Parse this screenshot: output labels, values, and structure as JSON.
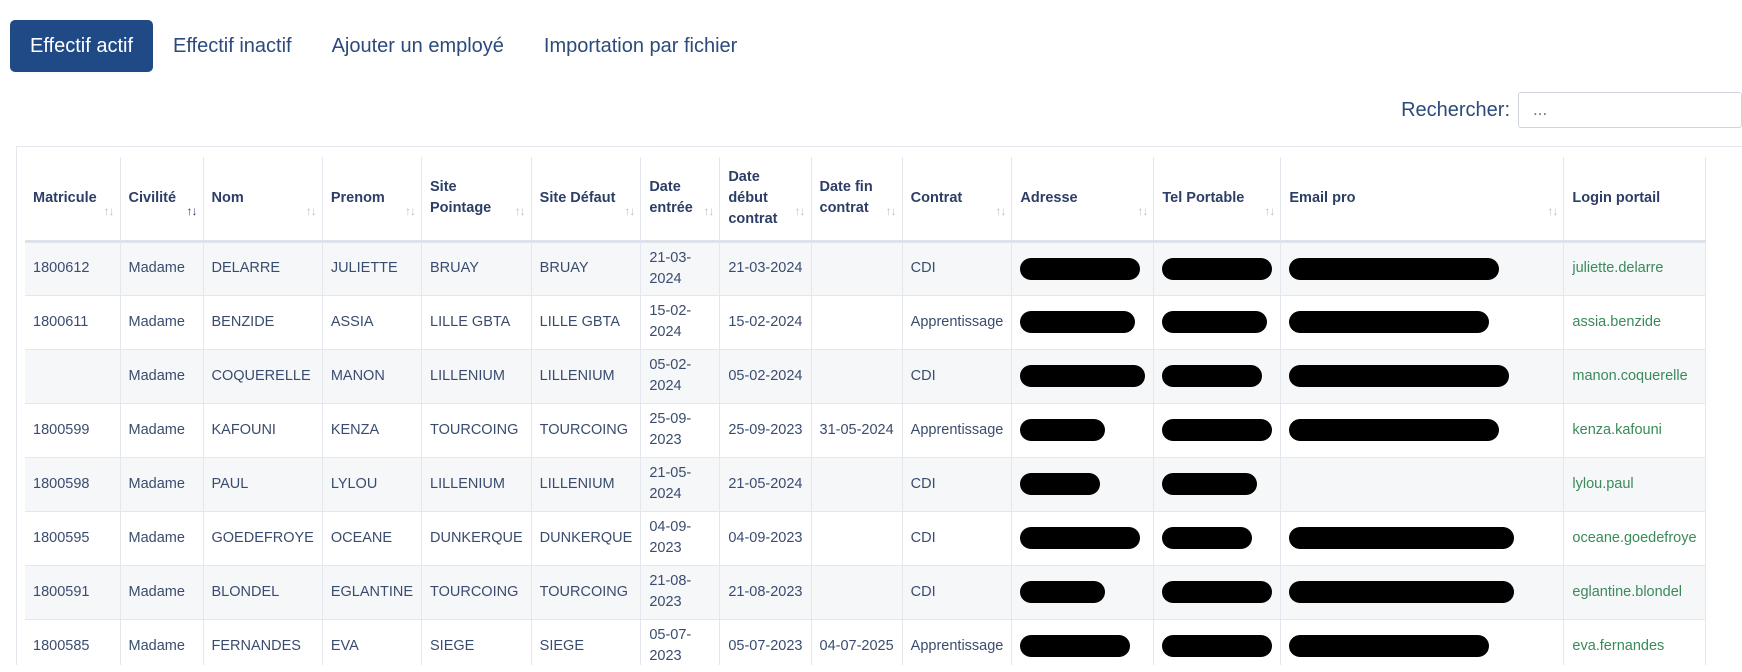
{
  "tabs": [
    "Effectif actif",
    "Effectif inactif",
    "Ajouter un employé",
    "Importation par fichier"
  ],
  "search": {
    "label": "Rechercher:",
    "placeholder": "..."
  },
  "columns": [
    "Matricule",
    "Civilité",
    "Nom",
    "Prenom",
    "Site Pointage",
    "Site Défaut",
    "Date entrée",
    "Date début contrat",
    "Date fin contrat",
    "Contrat",
    "Adresse",
    "Tel Portable",
    "Email pro",
    "Login portail"
  ],
  "sort_icon": "↑↓",
  "rows": [
    {
      "matricule": "1800612",
      "civilite": "Madame",
      "nom": "DELARRE",
      "prenom": "JULIETTE",
      "site_pointage": "BRUAY",
      "site_defaut": "BRUAY",
      "date_entree": "21-03-2024",
      "date_debut": "21-03-2024",
      "date_fin": "",
      "contrat": "CDI",
      "login": "juliette.delarre"
    },
    {
      "matricule": "1800611",
      "civilite": "Madame",
      "nom": "BENZIDE",
      "prenom": "ASSIA",
      "site_pointage": "LILLE GBTA",
      "site_defaut": "LILLE GBTA",
      "date_entree": "15-02-2024",
      "date_debut": "15-02-2024",
      "date_fin": "",
      "contrat": "Apprentissage",
      "login": "assia.benzide"
    },
    {
      "matricule": "",
      "civilite": "Madame",
      "nom": "COQUERELLE",
      "prenom": "MANON",
      "site_pointage": "LILLENIUM",
      "site_defaut": "LILLENIUM",
      "date_entree": "05-02-2024",
      "date_debut": "05-02-2024",
      "date_fin": "",
      "contrat": "CDI",
      "login": "manon.coquerelle"
    },
    {
      "matricule": "1800599",
      "civilite": "Madame",
      "nom": "KAFOUNI",
      "prenom": "KENZA",
      "site_pointage": "TOURCOING",
      "site_defaut": "TOURCOING",
      "date_entree": "25-09-2023",
      "date_debut": "25-09-2023",
      "date_fin": "31-05-2024",
      "contrat": "Apprentissage",
      "login": "kenza.kafouni"
    },
    {
      "matricule": "1800598",
      "civilite": "Madame",
      "nom": "PAUL",
      "prenom": "LYLOU",
      "site_pointage": "LILLENIUM",
      "site_defaut": "LILLENIUM",
      "date_entree": "21-05-2024",
      "date_debut": "21-05-2024",
      "date_fin": "",
      "contrat": "CDI",
      "login": "lylou.paul"
    },
    {
      "matricule": "1800595",
      "civilite": "Madame",
      "nom": "GOEDEFROYE",
      "prenom": "OCEANE",
      "site_pointage": "DUNKERQUE",
      "site_defaut": "DUNKERQUE",
      "date_entree": "04-09-2023",
      "date_debut": "04-09-2023",
      "date_fin": "",
      "contrat": "CDI",
      "login": "oceane.goedefroye"
    },
    {
      "matricule": "1800591",
      "civilite": "Madame",
      "nom": "BLONDEL",
      "prenom": "EGLANTINE",
      "site_pointage": "TOURCOING",
      "site_defaut": "TOURCOING",
      "date_entree": "21-08-2023",
      "date_debut": "21-08-2023",
      "date_fin": "",
      "contrat": "CDI",
      "login": "eglantine.blondel"
    },
    {
      "matricule": "1800585",
      "civilite": "Madame",
      "nom": "FERNANDES",
      "prenom": "EVA",
      "site_pointage": "SIEGE",
      "site_defaut": "SIEGE",
      "date_entree": "05-07-2023",
      "date_debut": "05-07-2023",
      "date_fin": "04-07-2025",
      "contrat": "Apprentissage",
      "login": "eva.fernandes"
    }
  ]
}
